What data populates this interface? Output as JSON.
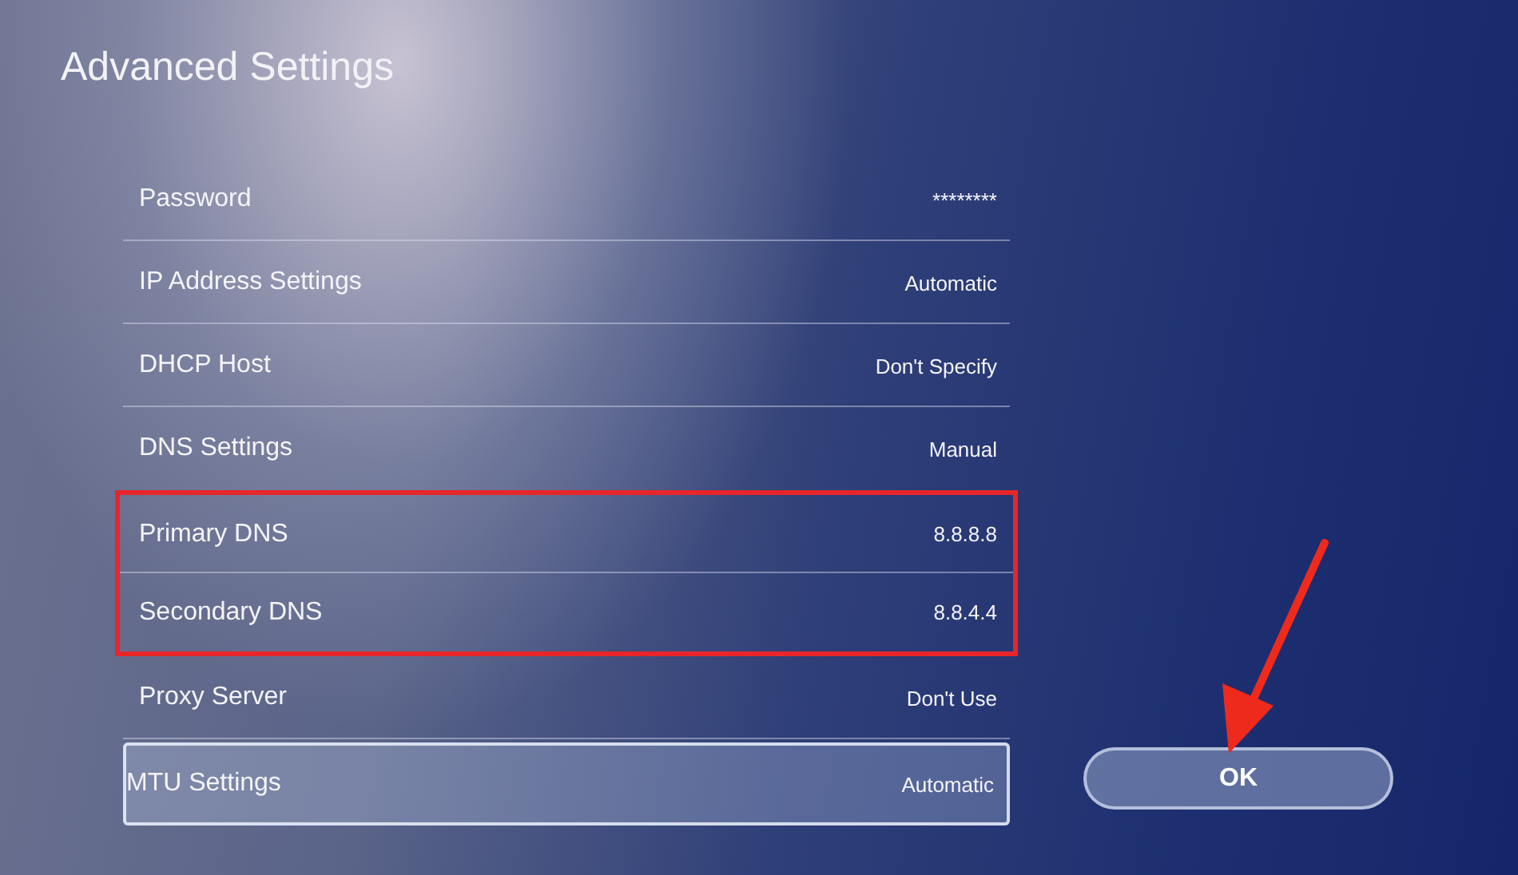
{
  "title": "Advanced Settings",
  "settings": [
    {
      "label": "Password",
      "value": "********",
      "focused": false,
      "highlighted": false
    },
    {
      "label": "IP Address Settings",
      "value": "Automatic",
      "focused": false,
      "highlighted": false
    },
    {
      "label": "DHCP Host",
      "value": "Don't Specify",
      "focused": false,
      "highlighted": false
    },
    {
      "label": "DNS Settings",
      "value": "Manual",
      "focused": false,
      "highlighted": false
    },
    {
      "label": "Primary DNS",
      "value": "8.8.8.8",
      "focused": false,
      "highlighted": true
    },
    {
      "label": "Secondary DNS",
      "value": "8.8.4.4",
      "focused": false,
      "highlighted": true
    },
    {
      "label": "Proxy Server",
      "value": "Don't Use",
      "focused": false,
      "highlighted": false
    },
    {
      "label": "MTU Settings",
      "value": "Automatic",
      "focused": true,
      "highlighted": false
    }
  ],
  "ok_button": {
    "label": "OK"
  }
}
